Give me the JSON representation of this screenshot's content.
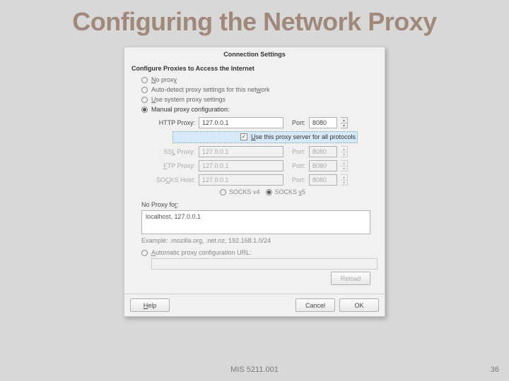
{
  "title": "Configuring the Network Proxy",
  "dialog": {
    "title": "Connection Settings",
    "heading": "Configure Proxies to Access the Internet",
    "opts": {
      "no_proxy": "No proxy",
      "auto_detect": "Auto-detect proxy settings for this network",
      "use_system": "Use system proxy settings",
      "manual": "Manual proxy configuration:"
    },
    "rows": {
      "http": {
        "label": "HTTP Proxy:",
        "host": "127.0.0.1",
        "port_lbl": "Port:",
        "port": "8080"
      },
      "ssl": {
        "label": "SSL Proxy:",
        "host": "127.0.0.1",
        "port_lbl": "Port:",
        "port": "8080"
      },
      "ftp": {
        "label": "FTP Proxy:",
        "host": "127.0.0.1",
        "port_lbl": "Port:",
        "port": "8080"
      },
      "socks": {
        "label": "SOCKS Host:",
        "host": "127.0.0.1",
        "port_lbl": "Port:",
        "port": "8080"
      }
    },
    "use_all": "Use this proxy server for all protocols",
    "socks_v4": "SOCKS v4",
    "socks_v5": "SOCKS v5",
    "noproxy_label": "No Proxy for:",
    "noproxy_value": "localhost, 127.0.0.1",
    "example": "Example: .mozilla.org, .net.nz, 192.168.1.0/24",
    "auto_url": "Automatic proxy configuration URL:",
    "reload": "Reload",
    "help": "Help",
    "cancel": "Cancel",
    "ok": "OK"
  },
  "footer": {
    "course": "MIS 5211.001",
    "page": "36"
  }
}
